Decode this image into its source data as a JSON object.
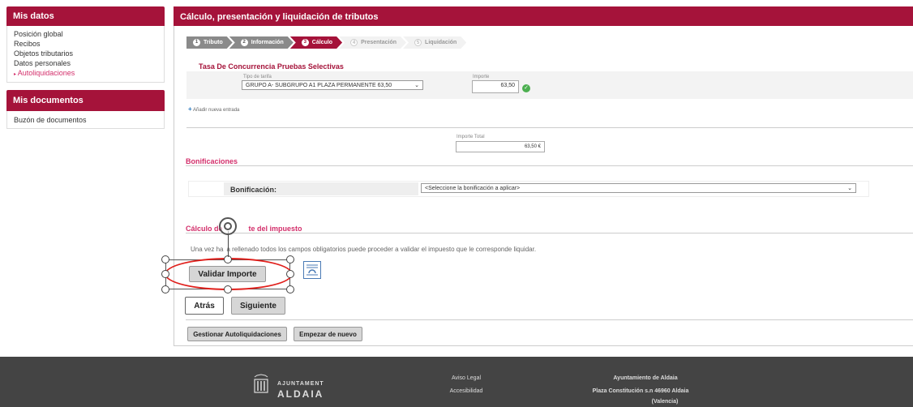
{
  "sidebar": {
    "mis_datos_title": "Mis datos",
    "items": [
      {
        "label": "Posición global"
      },
      {
        "label": "Recibos"
      },
      {
        "label": "Objetos tributarios"
      },
      {
        "label": "Datos personales"
      },
      {
        "label": "Autoliquidaciones"
      }
    ],
    "mis_documentos_title": "Mis documentos",
    "doc_items": [
      {
        "label": "Buzón de documentos"
      }
    ]
  },
  "main": {
    "title": "Cálculo, presentación y liquidación de tributos",
    "steps": [
      {
        "num": "1",
        "label": "Tributo"
      },
      {
        "num": "2",
        "label": "Información"
      },
      {
        "num": "3",
        "label": "Cálculo"
      },
      {
        "num": "4",
        "label": "Presentación"
      },
      {
        "num": "5",
        "label": "Liquidación"
      }
    ],
    "tasa_title": "Tasa De Concurrencia Pruebas Selectivas",
    "tipo_tarifa_label": "Tipo de tarifa",
    "tipo_tarifa_value": "GRUPO A- SUBGRUPO A1 PLAZA PERMANENTE 63,50",
    "importe_label": "Importe",
    "importe_value": "63,50",
    "add_entry": "Añadir nueva entrada",
    "importe_total_label": "Importe Total",
    "importe_total_value": "63,50 €",
    "bonificaciones_title": "Bonificaciones",
    "bonificacion_label": "Bonificación:",
    "bonificacion_placeholder": "<Seleccione la bonificación a aplicar>",
    "calculo_title_a": "Cálculo de",
    "calculo_title_b": "te del impuesto",
    "info_text_a": "Una vez ha",
    "info_text_b": "a rellenado todos los campos obligatorios puede proceder a validar el impuesto que le corresponde liquidar.",
    "validar_label": "Validar Importe",
    "atras_label": "Atrás",
    "siguiente_label": "Siguiente",
    "gestionar_label": "Gestionar Autoliquidaciones",
    "empezar_label": "Empezar de nuevo"
  },
  "footer": {
    "logo_line1": "AJUNTAMENT",
    "logo_line2": "ALDAIA",
    "aviso_legal": "Aviso Legal",
    "accesibilidad": "Accesibilidad",
    "org_name": "Ayuntamiento de Aldaia",
    "org_addr1": "Plaza Constitución s.n 46960 Aldaia",
    "org_addr2": "(Valencia)"
  },
  "colors": {
    "brand": "#a5133a",
    "accent_pink": "#d32f6b",
    "ok_green": "#4caf50",
    "annotation_red": "#e0201c"
  }
}
